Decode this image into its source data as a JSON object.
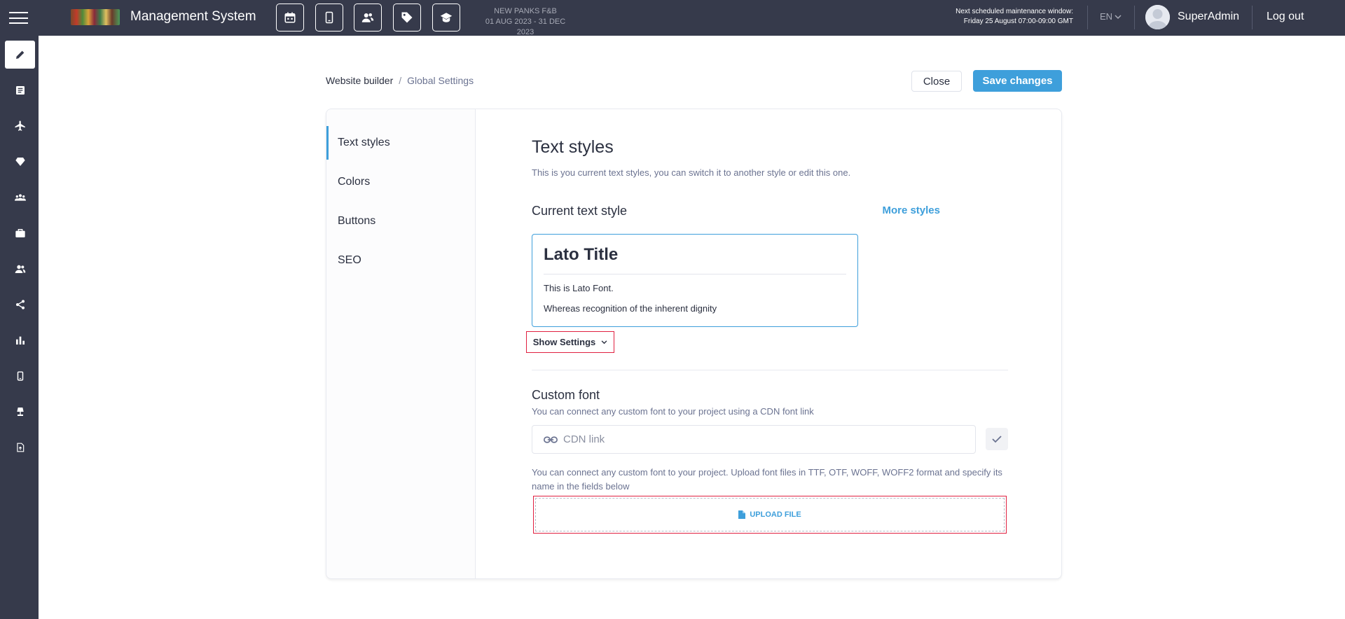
{
  "header": {
    "app_title": "Management System",
    "event_name": "NEW PANKS F&B",
    "event_dates": "01 AUG 2023 - 31 DEC 2023",
    "maintenance_label": "Next scheduled maintenance window:",
    "maintenance_time": "Friday 25 August 07:00-09:00 GMT",
    "language": "EN",
    "username": "SuperAdmin",
    "logout": "Log out",
    "toolbar_icons": [
      "calendar-icon",
      "mobile-icon",
      "users-icon",
      "tag-icon",
      "graduation-cap-icon"
    ]
  },
  "rail": {
    "icons": [
      "pencil-icon",
      "list-icon",
      "airplane-icon",
      "diamond-icon",
      "team-icon",
      "briefcase-icon",
      "people-icon",
      "share-icon",
      "bar-chart-icon",
      "mobile-icon",
      "lamp-icon",
      "file-upload-icon"
    ],
    "active_index": 0
  },
  "breadcrumb": {
    "root": "Website builder",
    "separator": "/",
    "current": "Global Settings"
  },
  "actions": {
    "close": "Close",
    "save": "Save changes"
  },
  "side_nav": {
    "items": [
      "Text styles",
      "Colors",
      "Buttons",
      "SEO"
    ],
    "active": "Text styles"
  },
  "content": {
    "title": "Text styles",
    "description": "This is you current text styles, you can switch it to another style or edit this one.",
    "current_label": "Current text style",
    "more_styles": "More styles",
    "preview": {
      "title": "Lato Title",
      "line1": "This is Lato Font.",
      "line2": "Whereas recognition of the inherent dignity"
    },
    "show_settings": "Show Settings",
    "custom_font": {
      "title": "Custom font",
      "description": "You can connect any custom font to your project using a CDN font link",
      "cdn_placeholder": "CDN link",
      "cdn_value": "",
      "upload_description": "You can connect any custom font to your project. Upload font files in TTF, OTF, WOFF, WOFF2 format and specify its name in the fields below",
      "upload_label": "UPLOAD FILE"
    }
  },
  "colors": {
    "topbar": "#363a4b",
    "accent": "#3e9fdb",
    "highlight": "#e02040"
  }
}
